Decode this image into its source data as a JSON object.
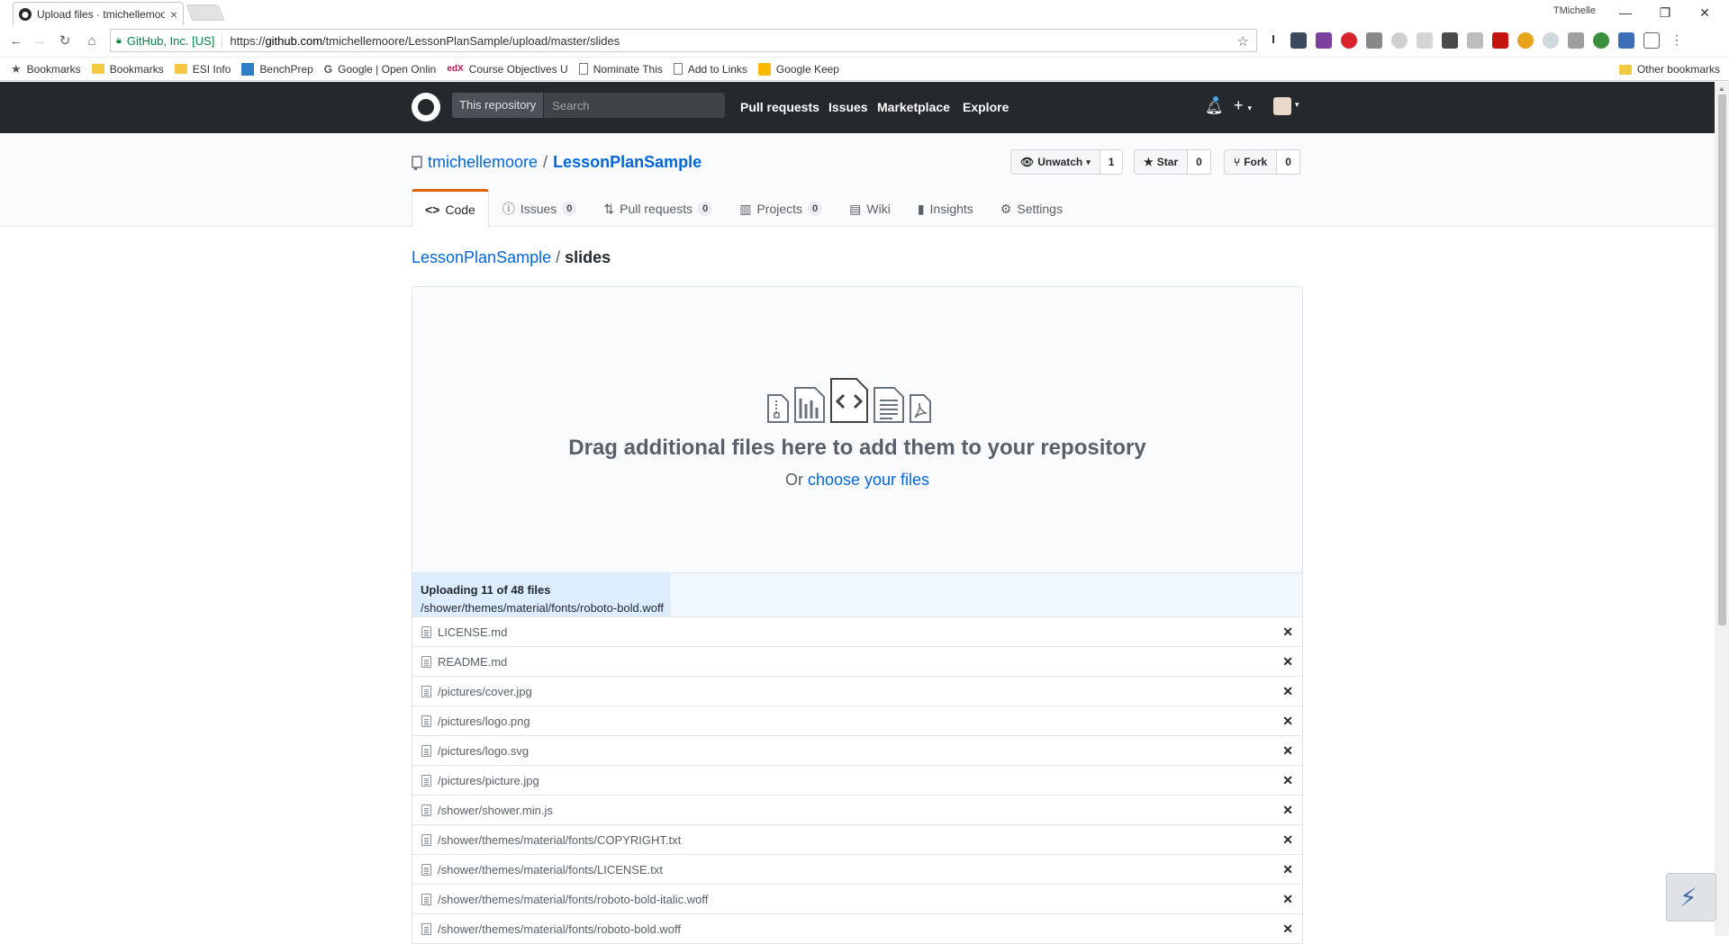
{
  "browser": {
    "tab_title": "Upload files · tmichellemoore",
    "tab_close": "×",
    "window_user": "TMichelle",
    "win_min": "—",
    "win_restore": "❐",
    "win_close": "✕",
    "secure_label": "GitHub, Inc. [US]",
    "url_scheme": "https://",
    "url_host": "github.com",
    "url_path": "/tmichellemoore/LessonPlanSample/upload/master/slides",
    "bookmarks": [
      {
        "label": "Bookmarks",
        "icon": "star-icon"
      },
      {
        "label": "Bookmarks",
        "icon": "folder-icon"
      },
      {
        "label": "ESI Info",
        "icon": "folder-icon"
      },
      {
        "label": "BenchPrep",
        "icon": "benchprep-icon"
      },
      {
        "label": "Google | Open Onlin",
        "icon": "google-icon"
      },
      {
        "label": "Course Objectives U",
        "icon": "edx-icon"
      },
      {
        "label": "Nominate This",
        "icon": "page-icon"
      },
      {
        "label": "Add to Links",
        "icon": "page-icon"
      },
      {
        "label": "Google Keep",
        "icon": "keep-icon"
      }
    ],
    "other_bookmarks": "Other bookmarks"
  },
  "github": {
    "scope_label": "This repository",
    "search_placeholder": "Search",
    "nav": [
      "Pull requests",
      "Issues",
      "Marketplace",
      "Explore"
    ],
    "owner": "tmichellemoore",
    "repo": "LessonPlanSample",
    "unwatch_label": "Unwatch",
    "watch_count": "1",
    "star_label": "Star",
    "star_count": "0",
    "fork_label": "Fork",
    "fork_count": "0",
    "tabs": [
      {
        "label": "Code",
        "count": null,
        "icon": "code-icon"
      },
      {
        "label": "Issues",
        "count": "0",
        "icon": "issue-icon"
      },
      {
        "label": "Pull requests",
        "count": "0",
        "icon": "pull-request-icon"
      },
      {
        "label": "Projects",
        "count": "0",
        "icon": "project-icon"
      },
      {
        "label": "Wiki",
        "count": null,
        "icon": "book-icon"
      },
      {
        "label": "Insights",
        "count": null,
        "icon": "graph-icon"
      },
      {
        "label": "Settings",
        "count": null,
        "icon": "gear-icon"
      }
    ]
  },
  "breadcrumb": {
    "repo": "LessonPlanSample",
    "sep": "/",
    "folder": "slides"
  },
  "dropzone": {
    "title": "Drag additional files here to add them to your repository",
    "or_text": "Or",
    "choose_link": "choose your files"
  },
  "upload": {
    "title": "Uploading 11 of 48 files",
    "current_path": "/shower/themes/material/fonts/roboto-bold.woff",
    "progress_fraction": 0.29
  },
  "files": [
    "LICENSE.md",
    "README.md",
    "/pictures/cover.jpg",
    "/pictures/logo.png",
    "/pictures/logo.svg",
    "/pictures/picture.jpg",
    "/shower/shower.min.js",
    "/shower/themes/material/fonts/COPYRIGHT.txt",
    "/shower/themes/material/fonts/LICENSE.txt",
    "/shower/themes/material/fonts/roboto-bold-italic.woff",
    "/shower/themes/material/fonts/roboto-bold.woff"
  ],
  "remove_glyph": "✕",
  "colors": {
    "header_bg": "#24292e",
    "link": "#0366d6",
    "tab_accent": "#e36209",
    "progress": "#dbedff"
  }
}
